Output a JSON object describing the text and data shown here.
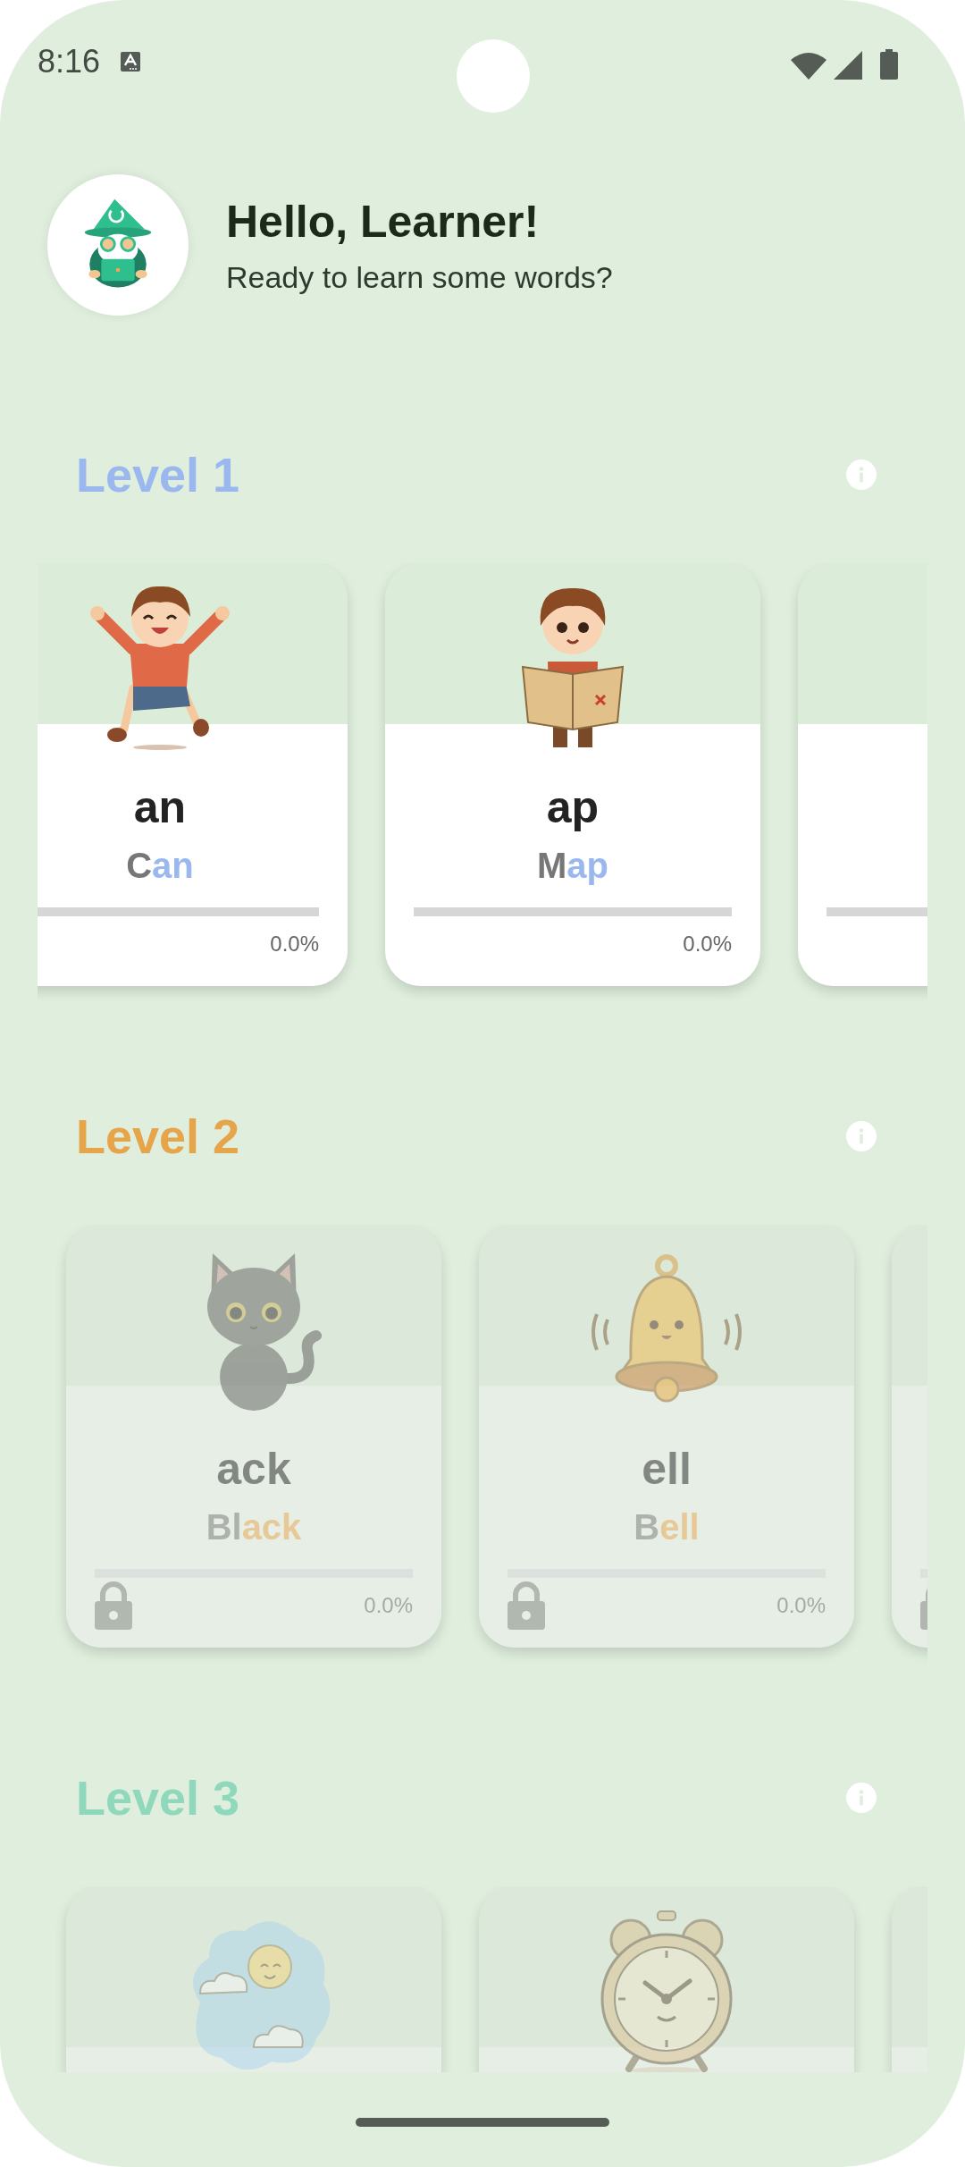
{
  "status_bar": {
    "time": "8:16"
  },
  "greeting": {
    "title": "Hello, Learner!",
    "subtitle": "Ready to learn some words?"
  },
  "levels": [
    {
      "title": "Level 1",
      "color": "#9bb8ee",
      "cards": [
        {
          "kind": "jumping",
          "family": "an",
          "example": [
            "C",
            "an"
          ],
          "locked": false,
          "level": 0,
          "progress": "0.0%"
        },
        {
          "kind": "map",
          "family": "ap",
          "example": [
            "M",
            "ap"
          ],
          "locked": false,
          "level": 0,
          "progress": "0.0%"
        },
        {
          "locked": false,
          "level": 0
        }
      ]
    },
    {
      "title": "Level 2",
      "color": "#e6a54a",
      "cards": [
        {
          "kind": "cat",
          "family": "ack",
          "example": [
            "Bl",
            "ack"
          ],
          "locked": true,
          "level": 0,
          "progress": "0.0%"
        },
        {
          "kind": "bell",
          "family": "ell",
          "example": [
            "B",
            "ell"
          ],
          "locked": true,
          "level": 0,
          "progress": "0.0%"
        },
        {
          "locked": true,
          "level": 0
        }
      ]
    },
    {
      "title": "Level 3",
      "color": "#8fd8bb",
      "cards": [
        {
          "kind": "weather",
          "locked": true
        },
        {
          "kind": "clock",
          "locked": true
        },
        {
          "locked": true
        }
      ]
    }
  ]
}
